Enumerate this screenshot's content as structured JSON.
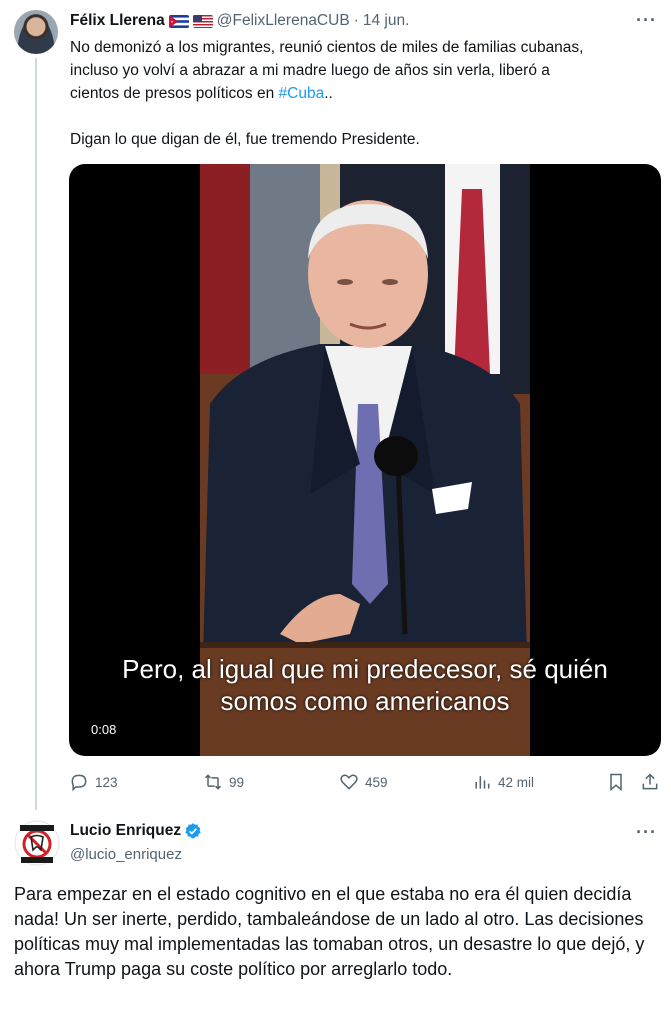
{
  "tweet1": {
    "author_name": "Félix Llerena",
    "flag_icons": [
      "cuba-flag-icon",
      "usa-flag-icon"
    ],
    "handle": "@FelixLlerenaCUB",
    "separator": "·",
    "time": "14 jun.",
    "more_label": "···",
    "text_lines": [
      "No demonizó a los migrantes, reunió cientos de miles de familias cubanas,",
      "incluso yo volví a abrazar a mi madre luego de años sin verla, liberó a",
      "cientos de presos políticos en "
    ],
    "hashtag": "#Cuba",
    "line3_suffix": "..",
    "text_line2": "Digan lo que digan de él, fue tremendo Presidente.",
    "video": {
      "subtitle_line1": "Pero, al igual que mi predecesor, sé quién",
      "subtitle_line2": "somos como americanos",
      "duration": "0:08"
    },
    "actions": {
      "replies": "123",
      "retweets": "99",
      "likes": "459",
      "views": "42 mil"
    }
  },
  "tweet2": {
    "author_name": "Lucio Enriquez",
    "verified_icon": "verified-badge-icon",
    "handle": "@lucio_enriquez",
    "more_label": "···",
    "avatar_text": [
      "NO MÁS",
      "MUELA"
    ],
    "body": "Para empezar en el estado cognitivo en el que estaba no era él quien decidía nada! Un ser inerte, perdido, tambaleándose de un lado al otro. Las decisiones políticas muy mal implementadas las tomaban otros, un desastre lo que dejó, y ahora Trump paga su coste político por arreglarlo todo."
  },
  "colors": {
    "text": "#0f1419",
    "secondary": "#536471",
    "link": "#1d9bf0",
    "verified": "#1d9bf0"
  }
}
